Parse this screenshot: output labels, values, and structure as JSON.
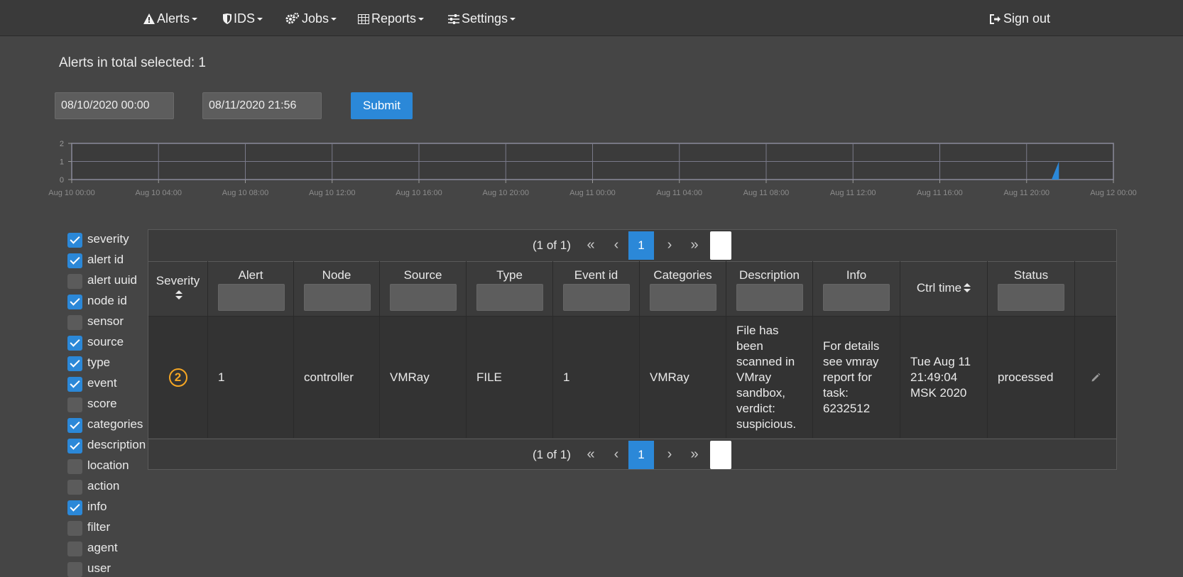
{
  "nav": {
    "alerts": "Alerts",
    "ids": "IDS",
    "jobs": "Jobs",
    "reports": "Reports",
    "settings": "Settings",
    "sign_out": "Sign out"
  },
  "header": {
    "total_label": "Alerts in total selected: 1",
    "date_from": "08/10/2020 00:00",
    "date_to": "08/11/2020 21:56",
    "submit_label": "Submit"
  },
  "chart_data": {
    "type": "area",
    "x_ticks": [
      "Aug 10 00:00",
      "Aug 10 04:00",
      "Aug 10 08:00",
      "Aug 10 12:00",
      "Aug 10 16:00",
      "Aug 10 20:00",
      "Aug 11 00:00",
      "Aug 11 04:00",
      "Aug 11 08:00",
      "Aug 11 12:00",
      "Aug 11 16:00",
      "Aug 11 20:00",
      "Aug 12 00:00"
    ],
    "y_ticks": [
      "2",
      "1",
      "0"
    ],
    "ylim": [
      0,
      2
    ],
    "x_range_hours": [
      0,
      48
    ],
    "series": [
      {
        "points": [
          [
            45.15,
            0
          ],
          [
            45.49,
            1
          ],
          [
            45.49,
            0
          ]
        ]
      }
    ],
    "series_color": "#2b88d8",
    "grid": true
  },
  "columns": [
    {
      "label": "severity",
      "checked": true
    },
    {
      "label": "alert id",
      "checked": true
    },
    {
      "label": "alert uuid",
      "checked": false
    },
    {
      "label": "node id",
      "checked": true
    },
    {
      "label": "sensor",
      "checked": false
    },
    {
      "label": "source",
      "checked": true
    },
    {
      "label": "type",
      "checked": true
    },
    {
      "label": "event",
      "checked": true
    },
    {
      "label": "score",
      "checked": false
    },
    {
      "label": "categories",
      "checked": true
    },
    {
      "label": "description",
      "checked": true
    },
    {
      "label": "location",
      "checked": false
    },
    {
      "label": "action",
      "checked": false
    },
    {
      "label": "info",
      "checked": true
    },
    {
      "label": "filter",
      "checked": false
    },
    {
      "label": "agent",
      "checked": false
    },
    {
      "label": "user",
      "checked": false
    }
  ],
  "paginator": {
    "status": "(1 of 1)",
    "first": "«",
    "prev": "‹",
    "page": "1",
    "next": "›",
    "last": "»"
  },
  "table": {
    "headers": {
      "severity": "Severity",
      "alert": "Alert",
      "node": "Node",
      "source": "Source",
      "type": "Type",
      "event_id": "Event id",
      "categories": "Categories",
      "description": "Description",
      "info": "Info",
      "ctrl_time": "Ctrl time",
      "status": "Status"
    },
    "row": {
      "severity": "2",
      "alert": "1",
      "node": "controller",
      "source": "VMRay",
      "type": "FILE",
      "event_id": "1",
      "categories": "VMRay",
      "description": "File has been scanned in VMray sandbox, verdict: suspicious.",
      "info": "For details see vmray report for task: 6232512",
      "ctrl_time": "Tue Aug 11 21:49:04 MSK 2020",
      "status": "processed"
    },
    "severity_color": "#f5a623",
    "accent": "#2b88d8"
  }
}
